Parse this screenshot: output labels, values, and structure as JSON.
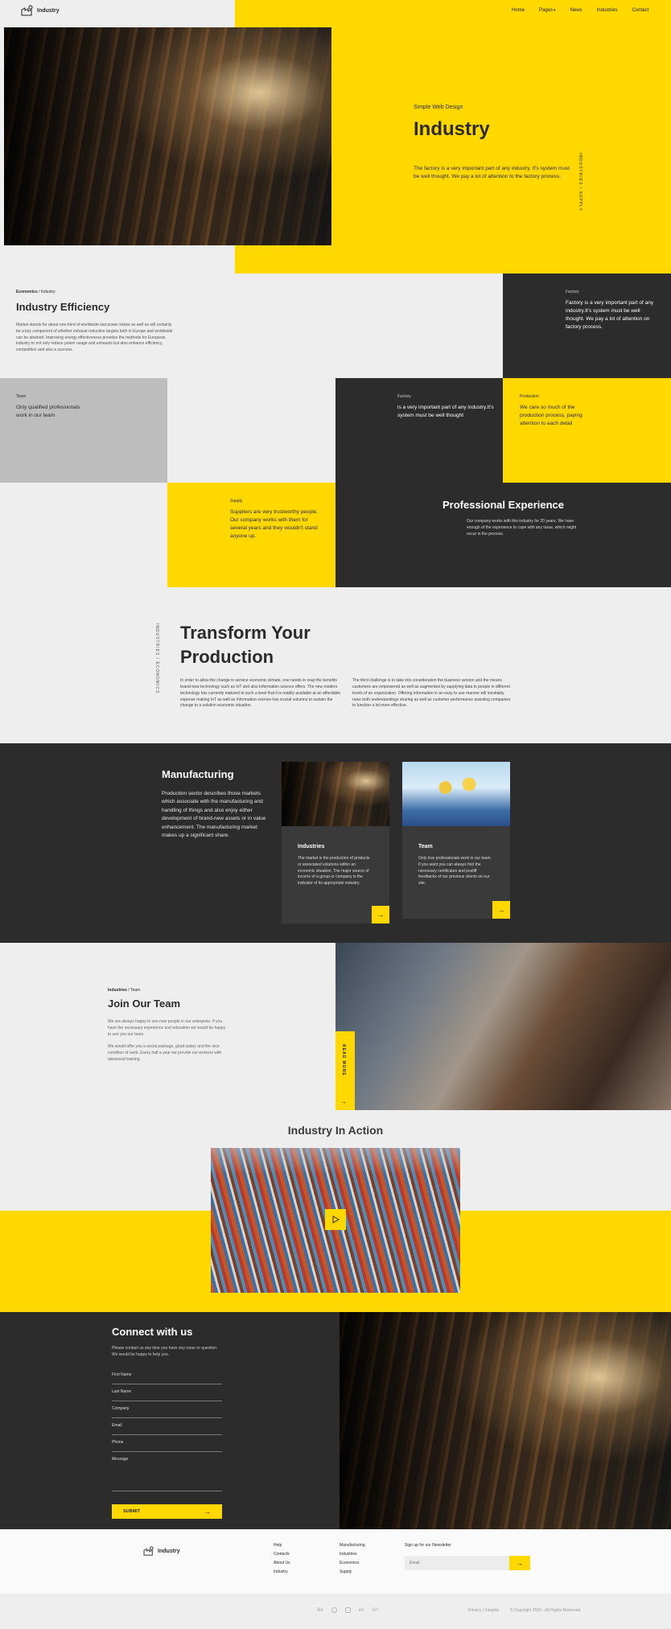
{
  "brand": {
    "name": "Industry"
  },
  "nav": {
    "items": [
      "Home",
      "Pages",
      "News",
      "Industries",
      "Contact"
    ],
    "dropdown_icon": "caret-down"
  },
  "hero": {
    "kicker": "Simple Web Design",
    "title": "Industry",
    "text": "The factory is a very important part of any industry. It's system must be well thought. We pay a lot of attention to the factory process.",
    "vertical_label": "INDUSTRIES / SUPPLY"
  },
  "efficiency": {
    "crumb_strong": "Economics",
    "crumb_rest": " / Industry",
    "title": "Industry Efficiency",
    "text": "Market stands for about one-third of worldwide last power intake as well as will certainly be a key component of whether exhaust reduction targets both in Europe and worldwide can be attained. Improving energy effectiveness provides the methods for European industry to not only reduce power usage and exhausts but also enhance efficiency, competition and also a success."
  },
  "tiles": {
    "factory_top": {
      "label": "Factory",
      "text": "Factory is a very important part of any industry.It's system must be well thought. We pay a lot of attention on factory process."
    },
    "team": {
      "label": "Team",
      "text": "Only qualified professionals work in our team"
    },
    "factory": {
      "label": "Factory",
      "text": "is a very important part of any industry.It's system must be well thought"
    },
    "production": {
      "label": "Production",
      "text": "We care so much of the production process, paying attention to each detail"
    },
    "supply": {
      "label": "Supply",
      "text": "Suppliers are very trustworthy people. Our company works with them for several years and they wouldn't stand anyone up."
    },
    "experience": {
      "title": "Professional Experience",
      "text": "Our company works with this industry for 20 years. We have enough of the experience to cope with any issue, which might occur in the process."
    }
  },
  "transform": {
    "vertical_label": "INDUSTRIES / ECONOMICS",
    "title_line1": "Transform Your",
    "title_line2": "Production",
    "col1": "In order to allow the change to service economic climate, one needs to reap the benefits brand-new technology such as IoT and also Information science offers. The new modern technology has currently matured to such a level that it is readily available at an affordable expense making IoT as well as Information science has crucial columns to sustain the change to a solution economic situation.",
    "col2": "The third challenge is to take into consideration the business version and the means customers are empowered as well as augmented by supplying data to people in different levels of an organization. Offering information in an easy to use manner will inevitably raise both understandings sharing as well as customer performance assisting companies to function a lot more effective."
  },
  "manufacturing": {
    "title": "Manufacturing",
    "text": "Production sector describes those markets which associate with the manufacturing and handling of things and also enjoy either development of brand-new assets or in value enhancement. The manufacturing market makes up a significant share.",
    "cards": [
      {
        "title": "Industries",
        "text": "The market is the production of products or associated solutions within an economic situation. The major source of income of a group or company is the indicator of its appropriate industry."
      },
      {
        "title": "Team",
        "text": "Only true professionals work in our team. If you want you can always find the necessary certificates and postiff feedbacks of our previous clients on our site."
      }
    ]
  },
  "join": {
    "crumb_strong": "Industries",
    "crumb_rest": " / Team",
    "title": "Join Our Team",
    "p1": "We are always happy to see new people in our enterprise. If you have the necessary experience and education we would be happy to see you our team.",
    "p2": "We would offer you a social package, good salary and the nice condition of work. Every half a year we provide our workers with advanced training.",
    "vertical_button": "READ MORE"
  },
  "action": {
    "title": "Industry In Action"
  },
  "connect": {
    "title": "Connect with us",
    "text": "Please contact us any time you have any issue or question. We would be happy to help you.",
    "fields": [
      "First Name",
      "Last Name",
      "Company",
      "Email",
      "Phone",
      "Message"
    ],
    "submit": "SUBMIT"
  },
  "footer": {
    "col1": [
      "Help",
      "Contacts",
      "About Us",
      "Industry"
    ],
    "col2": [
      "Manufacturing",
      "Industries",
      "Economics",
      "Supply"
    ],
    "newsletter_title": "Sign up for our Newsletter",
    "email_placeholder": "Email",
    "social_icons": [
      "behance-icon",
      "dribbble-icon",
      "instagram-icon",
      "vk-icon",
      "google-plus-icon"
    ],
    "policy": "Privacy | Integrity",
    "copyright": "© Copyright 2020 - All Rights Reserved"
  },
  "colors": {
    "accent": "#ffd800",
    "dark": "#2c2c2c",
    "light": "#eeeeee"
  }
}
